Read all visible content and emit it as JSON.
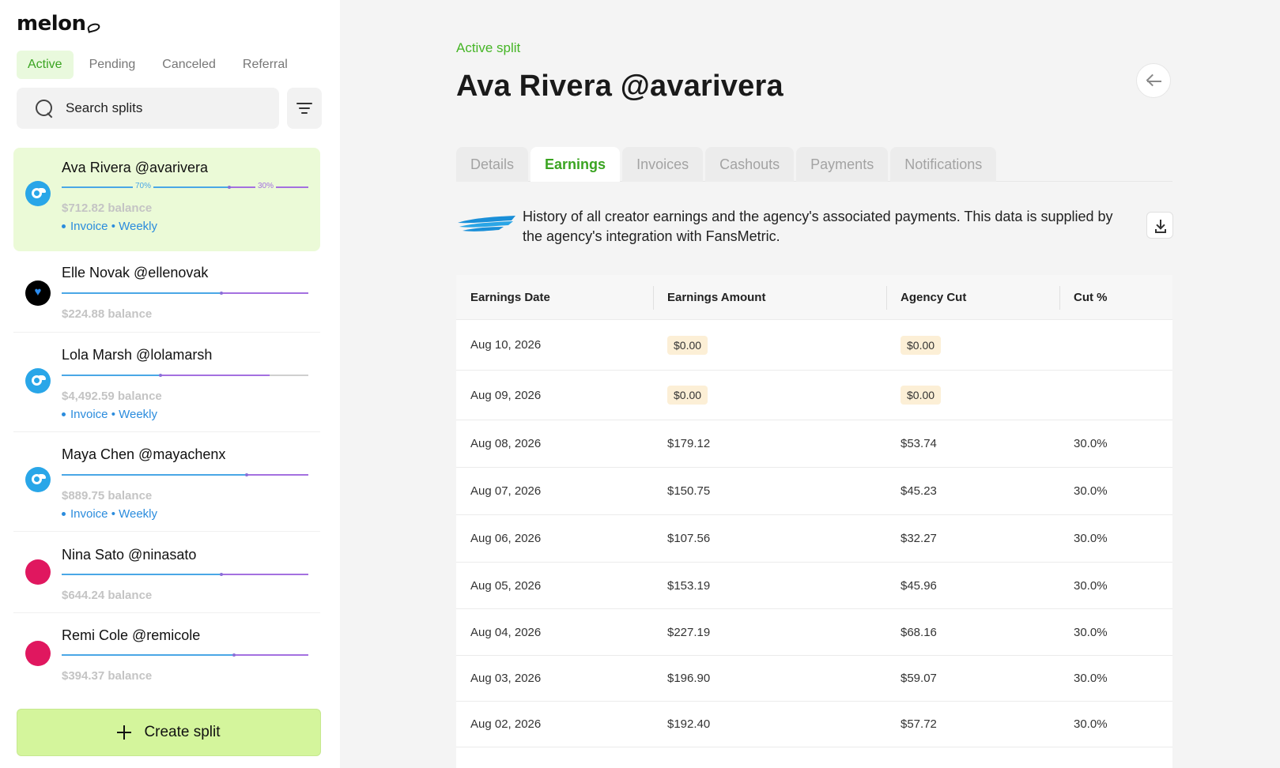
{
  "app": {
    "logo": "melon"
  },
  "sidebar": {
    "status_tabs": [
      "Active",
      "Pending",
      "Canceled",
      "Referral"
    ],
    "search_placeholder": "Search splits",
    "splits": [
      {
        "name": "Ava Rivera @avarivera",
        "balance": "$712.82 balance",
        "meta": "Invoice • Weekly",
        "creator_pct": "70%",
        "agency_pct": "30%",
        "platform": "onlyfans"
      },
      {
        "name": "Elle Novak @ellenovak",
        "balance": "$224.88 balance",
        "platform": "fansly"
      },
      {
        "name": "Lola Marsh @lolamarsh",
        "balance": "$4,492.59 balance",
        "meta": "Invoice • Weekly",
        "platform": "onlyfans"
      },
      {
        "name": "Maya Chen @mayachenx",
        "balance": "$889.75 balance",
        "meta": "Invoice • Weekly",
        "platform": "onlyfans"
      },
      {
        "name": "Nina Sato @ninasato",
        "balance": "$644.24 balance",
        "platform": "other"
      },
      {
        "name": "Remi Cole @remicole",
        "balance": "$394.37 balance",
        "platform": "other"
      }
    ],
    "create_label": "Create split"
  },
  "main": {
    "eyebrow": "Active split",
    "title": "Ava Rivera @avarivera",
    "tabs": [
      "Details",
      "Earnings",
      "Invoices",
      "Cashouts",
      "Payments",
      "Notifications"
    ],
    "active_tab": "Earnings",
    "info_text": "History of all creator earnings and the agency's associated payments. This data is supplied by the agency's integration with FansMetric.",
    "table": {
      "columns": [
        "Earnings Date",
        "Earnings Amount",
        "Agency Cut",
        "Cut %"
      ],
      "rows": [
        {
          "date": "Aug 10, 2026",
          "amount": "$0.00",
          "cut": "$0.00",
          "pct": "",
          "highlight": true
        },
        {
          "date": "Aug 09, 2026",
          "amount": "$0.00",
          "cut": "$0.00",
          "pct": "",
          "highlight": true
        },
        {
          "date": "Aug 08, 2026",
          "amount": "$179.12",
          "cut": "$53.74",
          "pct": "30.0%"
        },
        {
          "date": "Aug 07, 2026",
          "amount": "$150.75",
          "cut": "$45.23",
          "pct": "30.0%"
        },
        {
          "date": "Aug 06, 2026",
          "amount": "$107.56",
          "cut": "$32.27",
          "pct": "30.0%"
        },
        {
          "date": "Aug 05, 2026",
          "amount": "$153.19",
          "cut": "$45.96",
          "pct": "30.0%"
        },
        {
          "date": "Aug 04, 2026",
          "amount": "$227.19",
          "cut": "$68.16",
          "pct": "30.0%"
        },
        {
          "date": "Aug 03, 2026",
          "amount": "$196.90",
          "cut": "$59.07",
          "pct": "30.0%"
        },
        {
          "date": "Aug 02, 2026",
          "amount": "$192.40",
          "cut": "$57.72",
          "pct": "30.0%"
        }
      ]
    }
  },
  "colors": {
    "accent_green": "#45b525",
    "selected_bg": "#ebfad7",
    "create_bg": "#d4f59c",
    "link_blue": "#2b8cdd",
    "creator_bar": "#4aa7e6",
    "agency_bar": "#a470e0",
    "badge_bg": "#fcefd6"
  },
  "icons": {
    "search": "search-icon",
    "filter": "filter-icon",
    "back": "arrow-left-icon",
    "download": "download-icon",
    "plus": "plus-icon",
    "integration": "fansmetric-logo-icon"
  }
}
